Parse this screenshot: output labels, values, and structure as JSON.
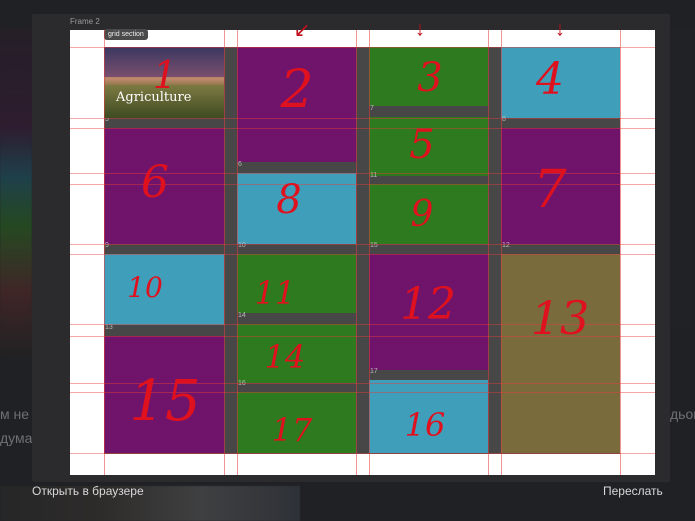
{
  "viewer": {
    "frame_label": "Frame 2",
    "badge": "grid section",
    "photo_caption": "Agriculture"
  },
  "cells": [
    {
      "id": "1",
      "corner": "",
      "color": "photo"
    },
    {
      "id": "2",
      "corner": "",
      "color": "purple"
    },
    {
      "id": "3",
      "corner": "",
      "color": "green"
    },
    {
      "id": "4",
      "corner": "",
      "color": "blue"
    },
    {
      "id": "5",
      "corner": "7",
      "color": "green"
    },
    {
      "id": "6",
      "corner": "5",
      "color": "purple"
    },
    {
      "id": "7",
      "corner": "8",
      "color": "purple"
    },
    {
      "id": "8",
      "corner": "6",
      "color": "blue"
    },
    {
      "id": "9",
      "corner": "11",
      "color": "green"
    },
    {
      "id": "10",
      "corner": "9",
      "color": "blue"
    },
    {
      "id": "11",
      "corner": "10",
      "color": "green"
    },
    {
      "id": "12",
      "corner": "15",
      "color": "purple"
    },
    {
      "id": "13",
      "corner": "12",
      "color": "olive"
    },
    {
      "id": "14",
      "corner": "14",
      "color": "green"
    },
    {
      "id": "15",
      "corner": "13",
      "color": "purple"
    },
    {
      "id": "16",
      "corner": "17",
      "color": "blue"
    },
    {
      "id": "17",
      "corner": "16",
      "color": "green"
    }
  ],
  "footer": {
    "open_in_browser": "Открыть в браузере",
    "forward": "Переслать"
  },
  "background_text": {
    "left_fragment_1": "м не",
    "left_fragment_2": "думал",
    "right_fragment": "дьоц"
  },
  "colors": {
    "purple": "#70136a",
    "green": "#2d7a1f",
    "blue": "#3f9fbb",
    "olive": "#7a6b3d",
    "annotation_red": "#e0111e"
  }
}
